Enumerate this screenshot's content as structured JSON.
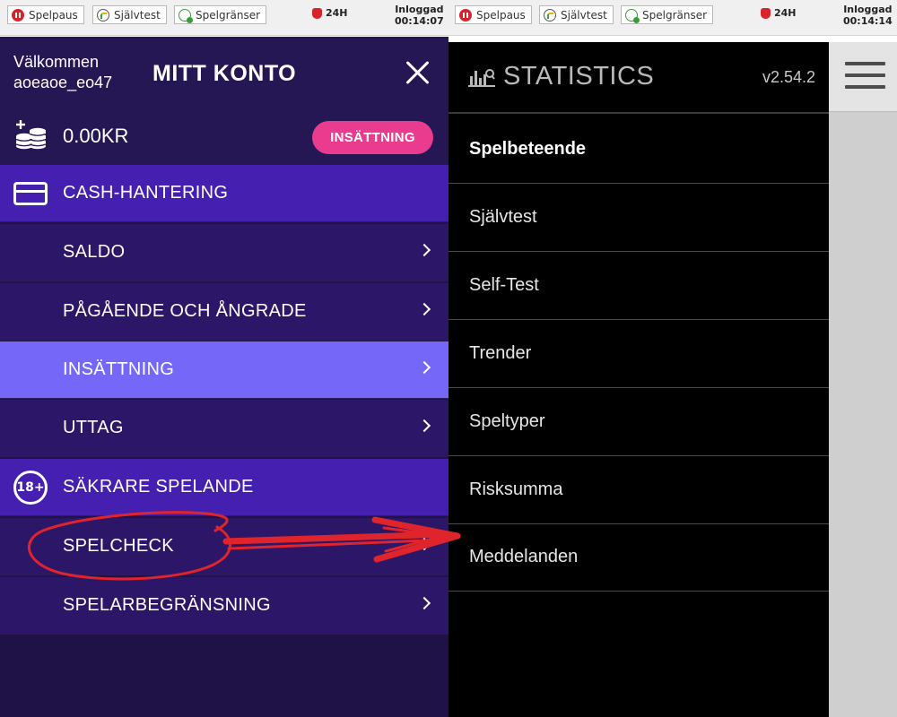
{
  "left_topbar": {
    "buttons": [
      {
        "label": "Spelpaus",
        "icon": "pause-icon"
      },
      {
        "label": "Självtest",
        "icon": "gauge-icon"
      },
      {
        "label": "Spelgränser",
        "icon": "limit-icon"
      }
    ],
    "badge": "24H",
    "login_label": "Inloggad",
    "login_time": "00:14:07"
  },
  "right_topbar": {
    "buttons": [
      {
        "label": "Spelpaus",
        "icon": "pause-icon"
      },
      {
        "label": "Självtest",
        "icon": "gauge-icon"
      },
      {
        "label": "Spelgränser",
        "icon": "limit-icon"
      }
    ],
    "badge": "24H",
    "login_label": "Inloggad",
    "login_time": "00:14:14"
  },
  "account": {
    "welcome": "Välkommen",
    "username": "aoeaoe_eo47",
    "title": "MITT KONTO",
    "balance": "0.00KR",
    "deposit_button": "INSÄTTNING"
  },
  "menu": {
    "cash_section": "CASH-HANTERING",
    "items_cash": [
      "SALDO",
      "PÅGÅENDE OCH ÅNGRADE",
      "INSÄTTNING",
      "UTTAG"
    ],
    "safer_section": "SÄKRARE SPELANDE",
    "age_badge": "18+",
    "items_safer": [
      "SPELCHECK",
      "SPELARBEGRÄNSNING"
    ],
    "active_item": "INSÄTTNING"
  },
  "statistics": {
    "title": "STATISTICS",
    "version": "v2.54.2",
    "items": [
      "Spelbeteende",
      "Självtest",
      "Self-Test",
      "Trender",
      "Speltyper",
      "Risksumma",
      "Meddelanden"
    ]
  },
  "colors": {
    "panel_bg": "#1f1246",
    "section_bg": "#4520b0",
    "item_bg": "#2c1668",
    "active_bg": "#7568f9",
    "deposit_pink": "#ea3c8f",
    "annotation_red": "#e0242b"
  }
}
